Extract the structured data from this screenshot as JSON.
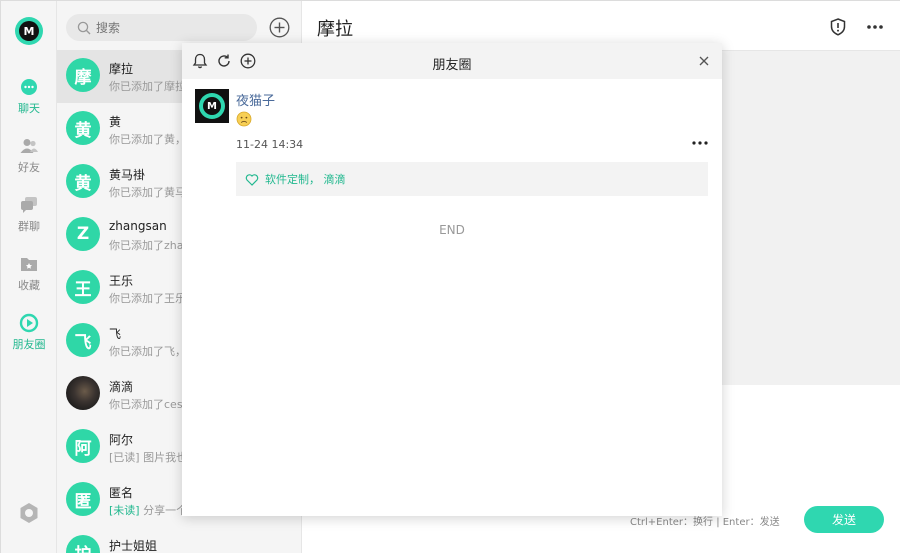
{
  "app": {
    "logo_letter": "M"
  },
  "rail": {
    "items": [
      {
        "label": "聊天",
        "icon": "chat-bubble-icon"
      },
      {
        "label": "好友",
        "icon": "friends-icon"
      },
      {
        "label": "群聊",
        "icon": "group-chat-icon"
      },
      {
        "label": "收藏",
        "icon": "folder-icon"
      },
      {
        "label": "朋友圈",
        "icon": "moments-icon"
      }
    ],
    "settings_icon": "gear-icon"
  },
  "search": {
    "placeholder": "搜索"
  },
  "contacts": [
    {
      "name": "摩拉",
      "avatar": "摩",
      "tag": "",
      "message": "你已添加了摩拉"
    },
    {
      "name": "黄",
      "avatar": "黄",
      "tag": "",
      "message": "你已添加了黄，"
    },
    {
      "name": "黄马褂",
      "avatar": "黄",
      "tag": "",
      "message": "你已添加了黄马"
    },
    {
      "name": "zhangsan",
      "avatar": "Z",
      "tag": "",
      "message": "你已添加了zhan"
    },
    {
      "name": "王乐",
      "avatar": "王",
      "tag": "",
      "message": "你已添加了王乐"
    },
    {
      "name": "飞",
      "avatar": "飞",
      "tag": "",
      "message": "你已添加了飞，"
    },
    {
      "name": "滴滴",
      "avatar": "",
      "tag": "",
      "message": "你已添加了cess"
    },
    {
      "name": "阿尔",
      "avatar": "阿",
      "tag": "[已读]",
      "message": " 图片我也"
    },
    {
      "name": "匿名",
      "avatar": "匿",
      "tag": "[未读]",
      "message": " 分享一个"
    },
    {
      "name": "护士姐姐",
      "avatar": "护",
      "tag": "",
      "message": ""
    }
  ],
  "main": {
    "title": "摩拉",
    "hint": "Ctrl+Enter：换行    |    Enter：发送",
    "send_label": "发送"
  },
  "moments": {
    "title": "朋友圈",
    "post": {
      "author": "夜猫子",
      "time": "11-24 14:34",
      "likes": "软件定制， 滴滴"
    },
    "end_text": "END"
  },
  "colors": {
    "accent": "#2fd7b0",
    "link": "#4a6a9a"
  }
}
